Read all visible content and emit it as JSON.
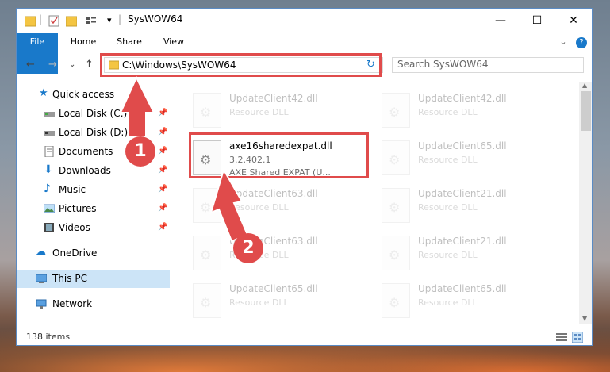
{
  "window": {
    "title": "SysWOW64",
    "minimize": "—",
    "maximize": "☐",
    "close": "✕"
  },
  "ribbon": {
    "tabs": [
      "File",
      "Home",
      "Share",
      "View"
    ],
    "chevron": "⌄",
    "help": "?"
  },
  "address": {
    "path": "C:\\Windows\\SysWOW64",
    "refresh": "↻",
    "search_placeholder": "Search SysWOW64"
  },
  "nav": {
    "back": "←",
    "forward": "→",
    "recent": "⌄",
    "up": "↑",
    "items": [
      {
        "label": "Quick access",
        "icon": "star-icon",
        "pinned": false
      },
      {
        "label": "Local Disk (C:)",
        "icon": "drive-icon",
        "pinned": true
      },
      {
        "label": "Local Disk (D:)",
        "icon": "drive-icon",
        "pinned": true
      },
      {
        "label": "Documents",
        "icon": "documents-icon",
        "pinned": true
      },
      {
        "label": "Downloads",
        "icon": "downloads-icon",
        "pinned": true
      },
      {
        "label": "Music",
        "icon": "music-icon",
        "pinned": true
      },
      {
        "label": "Pictures",
        "icon": "pictures-icon",
        "pinned": true
      },
      {
        "label": "Videos",
        "icon": "videos-icon",
        "pinned": true
      },
      {
        "label": "OneDrive",
        "icon": "onedrive-icon",
        "pinned": false
      },
      {
        "label": "This PC",
        "icon": "this-pc-icon",
        "pinned": false
      },
      {
        "label": "Network",
        "icon": "network-icon",
        "pinned": false
      }
    ]
  },
  "files": {
    "highlighted": {
      "name": "axe16sharedexpat.dll",
      "version": "3.2.402.1",
      "desc": "AXE Shared EXPAT (U..."
    },
    "faded": [
      {
        "name": "UpdateClient42.dll",
        "desc": "Resource DLL"
      },
      {
        "name": "UpdateClient42.dll",
        "desc": "Resource DLL"
      },
      {
        "name": "UpdateClient65.dll",
        "desc": "Resource DLL"
      },
      {
        "name": "UpdateClient63.dll",
        "desc": "Resource DLL"
      },
      {
        "name": "UpdateClient21.dll",
        "desc": "Resource DLL"
      },
      {
        "name": "UpdateClient63.dll",
        "desc": "Resource DLL"
      },
      {
        "name": "UpdateClient21.dll",
        "desc": "Resource DLL"
      },
      {
        "name": "UpdateClient65.dll",
        "desc": "Resource DLL"
      },
      {
        "name": "UpdateClient65.dll",
        "desc": "Resource DLL"
      }
    ]
  },
  "status": {
    "count": "138 items"
  },
  "annotations": {
    "step1": "1",
    "step2": "2"
  },
  "colors": {
    "accent": "#1979ca",
    "highlight_red": "#e04b4b",
    "selected_nav": "#cce4f7"
  }
}
